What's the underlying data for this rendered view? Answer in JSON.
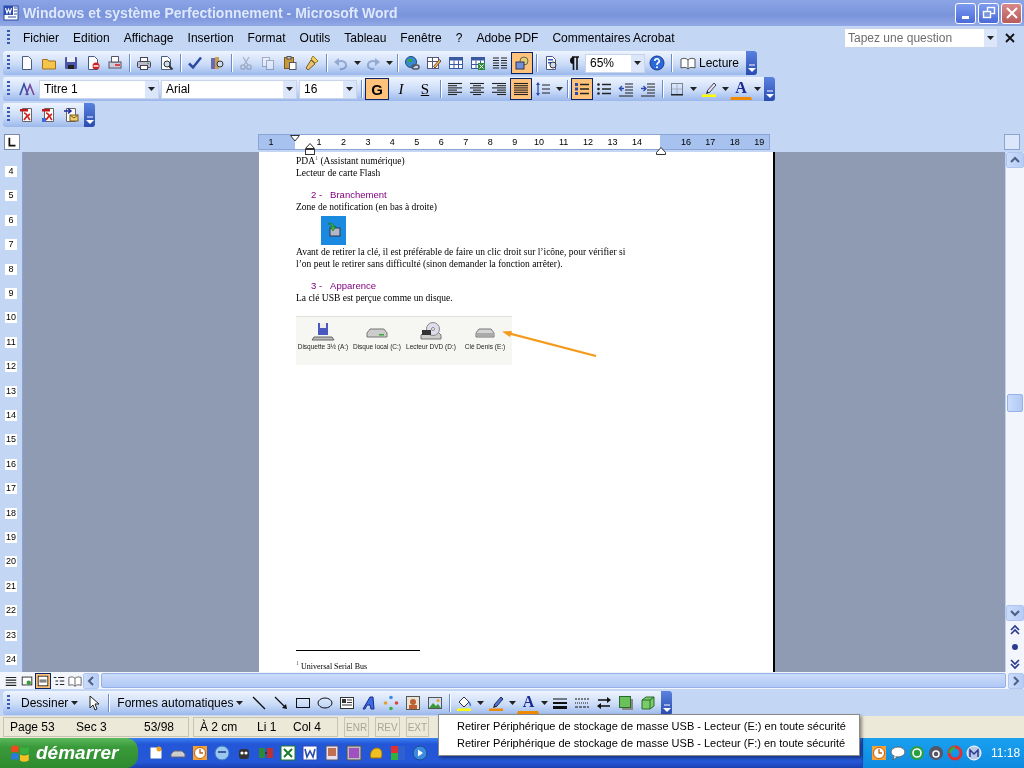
{
  "window": {
    "title": "Windows et système Perfectionnement - Microsoft Word"
  },
  "menu": [
    {
      "label": "Fichier"
    },
    {
      "label": "Edition"
    },
    {
      "label": "Affichage"
    },
    {
      "label": "Insertion"
    },
    {
      "label": "Format"
    },
    {
      "label": "Outils"
    },
    {
      "label": "Tableau"
    },
    {
      "label": "Fenêtre"
    },
    {
      "label": "?"
    },
    {
      "label": "Adobe PDF"
    },
    {
      "label": "Commentaires Acrobat"
    }
  ],
  "help_box": {
    "placeholder": "Tapez une question"
  },
  "standard_toolbar": {
    "cut": {
      "disabled": true
    },
    "copy": {
      "disabled": true
    },
    "undo": {
      "disabled": true
    },
    "redo": {
      "disabled": true
    },
    "drawing": {
      "selected": true
    },
    "zoom": "65%",
    "reading_button": "Lecture"
  },
  "formatting_toolbar": {
    "style": "Titre 1",
    "font": "Arial",
    "size": "16",
    "text_styles": [
      {
        "label": "G",
        "selected": true
      },
      {
        "label": "I",
        "selected": false
      },
      {
        "label": "S",
        "selected": false
      }
    ],
    "alignments": [
      {
        "selected": false
      },
      {
        "selected": false
      },
      {
        "selected": false
      },
      {
        "selected": true
      }
    ],
    "lists": [
      {
        "selected": true
      },
      {
        "selected": false
      }
    ],
    "font_color_glyph": "A"
  },
  "ruler": {
    "horizontal": [
      "1",
      "1",
      "2",
      "3",
      "4",
      "5",
      "6",
      "7",
      "8",
      "9",
      "10",
      "11",
      "12",
      "13",
      "14",
      "16",
      "17",
      "18",
      "19"
    ],
    "vertical": [
      "4",
      "5",
      "6",
      "7",
      "8",
      "9",
      "10",
      "11",
      "12",
      "13",
      "14",
      "15",
      "16",
      "17",
      "18",
      "19",
      "20",
      "21",
      "22",
      "23",
      "24"
    ]
  },
  "document": {
    "blocks": [
      {
        "kind": "text",
        "text": "PDA$^{1}$ (Assistant numérique)"
      },
      {
        "kind": "text",
        "text": "Lecteur de carte Flash"
      },
      {
        "kind": "heading",
        "number": "2 -",
        "text": "Branchement"
      },
      {
        "kind": "text",
        "text": "Zone de notification (en bas à droite)"
      },
      {
        "kind": "image"
      },
      {
        "kind": "paragraph",
        "lines": [
          "Avant de retirer la clé, il est préférable de faire un clic droit sur l’icône, pour vérifier si",
          "l’on peut le retirer sans difficulté (sinon demander la fonction arrêter)."
        ]
      },
      {
        "kind": "heading",
        "number": "3 -",
        "text": "Apparence"
      },
      {
        "kind": "text",
        "text": "La clé USB est perçue comme un disque."
      },
      {
        "kind": "drives",
        "items": [
          {
            "kind": "floppy",
            "label": "Disquette 3½ (A:)"
          },
          {
            "kind": "disk",
            "label": "Disque local (C:)"
          },
          {
            "kind": "dvd",
            "label": "Lecteur DVD (D:)"
          },
          {
            "kind": "removable",
            "label": "Clé Denis (E:)"
          }
        ]
      }
    ],
    "footnote": "$^{1}$ Universal Serial Bus"
  },
  "view_buttons": [
    {
      "selected": false
    },
    {
      "selected": false
    },
    {
      "selected": true
    },
    {
      "selected": false
    },
    {
      "selected": false
    }
  ],
  "drawing_toolbar": {
    "draw_menu": "Dessiner",
    "autoshapes": "Formes automatiques",
    "font_color_glyph": "A"
  },
  "status_bar": {
    "fields": [
      "Page 53",
      "Sec 3",
      "53/98",
      "À 2 cm",
      "Li 1",
      "Col 4"
    ],
    "indicators": [
      {
        "label": "ENR",
        "enabled": false
      },
      {
        "label": "REV",
        "enabled": false
      },
      {
        "label": "EXT",
        "enabled": false
      }
    ]
  },
  "taskbar": {
    "start": "démarrer",
    "clock": "11:18"
  },
  "context_menu": {
    "items": [
      "Retirer Périphérique de stockage de masse USB - Lecteur (E:) en toute sécurité",
      "Retirer Périphérique de stockage de masse USB - Lecteur (F:) en toute sécurité"
    ]
  }
}
